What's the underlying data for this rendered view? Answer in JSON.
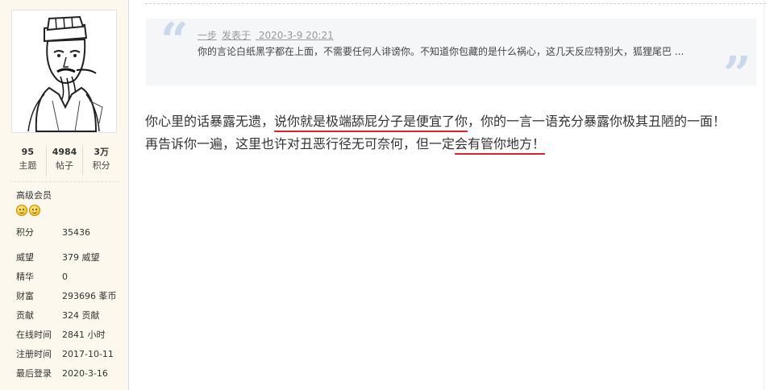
{
  "profile": {
    "avatar_alt": "avatar",
    "stats": [
      {
        "value": "95",
        "label": "主题"
      },
      {
        "value": "4984",
        "label": "帖子"
      },
      {
        "value": "3万",
        "label": "积分"
      }
    ],
    "group": "高级会员",
    "info": [
      {
        "key": "积分",
        "value": "35436"
      },
      {
        "key": "威望",
        "value": "379 威望"
      },
      {
        "key": "精华",
        "value": "0"
      },
      {
        "key": "财富",
        "value": "293696 莑币"
      },
      {
        "key": "贡献",
        "value": "324 贡献"
      },
      {
        "key": "在线时间",
        "value": "2841 小时"
      },
      {
        "key": "注册时间",
        "value": "2017-10-11"
      },
      {
        "key": "最后登录",
        "value": "2020-3-16"
      }
    ]
  },
  "quote": {
    "author": "一步",
    "posted_label": "发表于",
    "datetime": "2020-3-9 20:21",
    "text": "你的言论白纸黑字都在上面，不需要任何人诽谤你。不知道你包藏的是什么祸心，这几天反应特别大，狐狸尾巴 ..."
  },
  "post": {
    "line1_a": "你心里的话暴露无遗，",
    "line1_ul": "说你就是极端舔屁分子是便宜了你",
    "line1_b": "，你的一言一语充分暴露你极其丑陋的一面！",
    "line2_a": "再告诉你一遍，这里也许对丑恶行径无可奈何，但一定",
    "line2_ul": "会有管你地方！"
  },
  "colors": {
    "sidebar_bg": "#fdf8ed",
    "quote_bg": "#f4f6f8",
    "underline": "#e0202c"
  }
}
